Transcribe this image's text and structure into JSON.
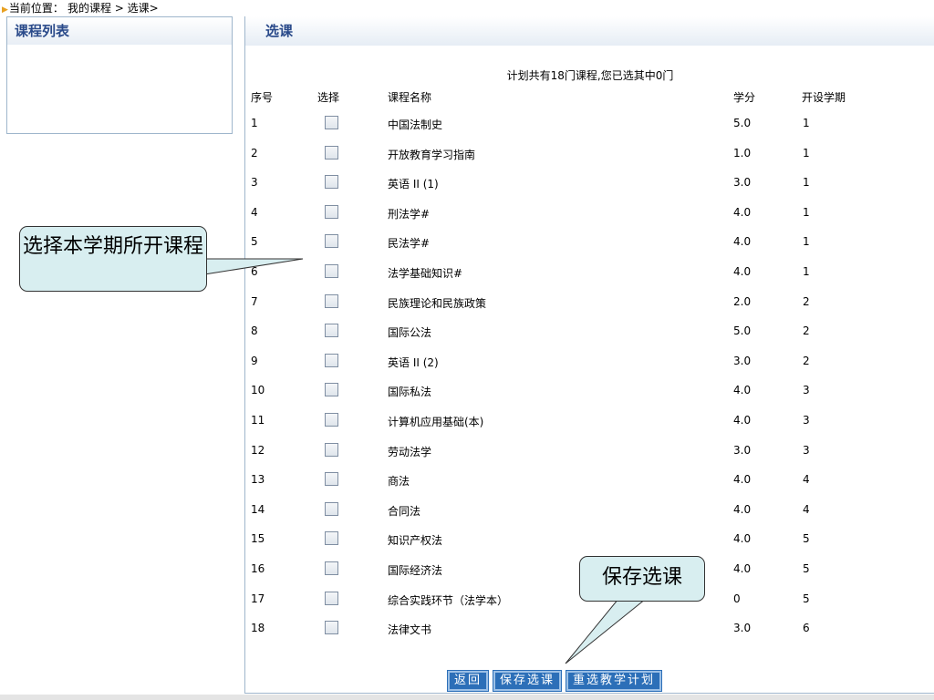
{
  "breadcrumb": {
    "prefix": "当前位置：",
    "path": "我的课程 > 选课>"
  },
  "sidebar": {
    "title": "课程列表"
  },
  "main": {
    "title": "选课",
    "summary": "计划共有18门课程,您已选其中0门",
    "headers": {
      "no": "序号",
      "select": "选择",
      "name": "课程名称",
      "credit": "学分",
      "term": "开设学期"
    },
    "courses": [
      {
        "no": "1",
        "name": "中国法制史",
        "credit": "5.0",
        "term": "1"
      },
      {
        "no": "2",
        "name": "开放教育学习指南",
        "credit": "1.0",
        "term": "1"
      },
      {
        "no": "3",
        "name": "英语 II (1)",
        "credit": "3.0",
        "term": "1"
      },
      {
        "no": "4",
        "name": "刑法学#",
        "credit": "4.0",
        "term": "1"
      },
      {
        "no": "5",
        "name": "民法学#",
        "credit": "4.0",
        "term": "1"
      },
      {
        "no": "6",
        "name": "法学基础知识#",
        "credit": "4.0",
        "term": "1"
      },
      {
        "no": "7",
        "name": "民族理论和民族政策",
        "credit": "2.0",
        "term": "2"
      },
      {
        "no": "8",
        "name": "国际公法",
        "credit": "5.0",
        "term": "2"
      },
      {
        "no": "9",
        "name": "英语 II (2)",
        "credit": "3.0",
        "term": "2"
      },
      {
        "no": "10",
        "name": "国际私法",
        "credit": "4.0",
        "term": "3"
      },
      {
        "no": "11",
        "name": "计算机应用基础(本)",
        "credit": "4.0",
        "term": "3"
      },
      {
        "no": "12",
        "name": "劳动法学",
        "credit": "3.0",
        "term": "3"
      },
      {
        "no": "13",
        "name": "商法",
        "credit": "4.0",
        "term": "4"
      },
      {
        "no": "14",
        "name": "合同法",
        "credit": "4.0",
        "term": "4"
      },
      {
        "no": "15",
        "name": "知识产权法",
        "credit": "4.0",
        "term": "5"
      },
      {
        "no": "16",
        "name": "国际经济法",
        "credit": "4.0",
        "term": "5"
      },
      {
        "no": "17",
        "name": "综合实践环节（法学本）",
        "credit": "0",
        "term": "5"
      },
      {
        "no": "18",
        "name": "法律文书",
        "credit": "3.0",
        "term": "6"
      }
    ],
    "buttons": {
      "back": "返回",
      "save": "保存选课",
      "reselect": "重选教学计划"
    }
  },
  "callouts": {
    "select_term": "选择本学期所开课程",
    "save": "保存选课"
  },
  "colors": {
    "accent": "#2c6fb8",
    "header_text": "#2a4a8a",
    "callout_bg": "#d8eef0"
  }
}
